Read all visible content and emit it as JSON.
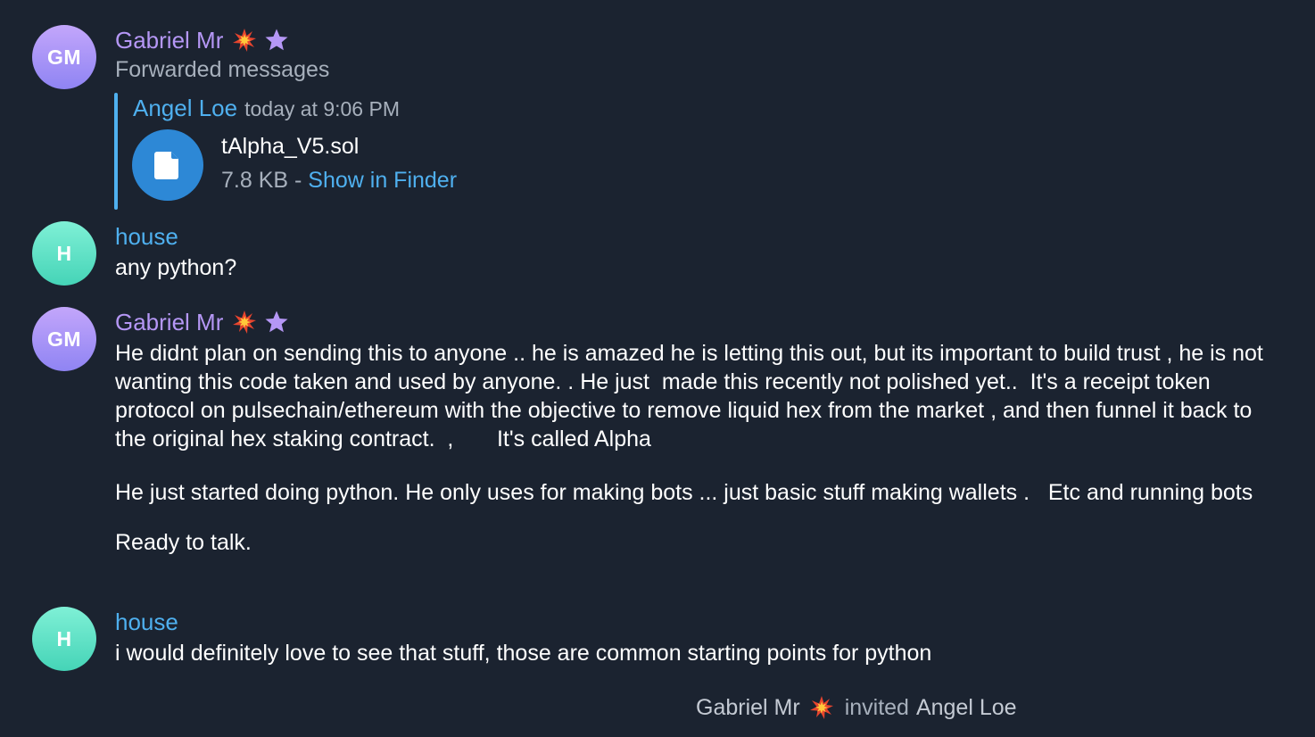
{
  "messages": [
    {
      "avatar_initials": "GM",
      "sender": "Gabriel Mr",
      "sender_badges": [
        "collision-emoji",
        "star-icon"
      ],
      "subtitle": "Forwarded messages",
      "forwarded": {
        "from": "Angel Loe",
        "time": "today at 9:06 PM",
        "file": {
          "icon": "file-icon",
          "name": "tAlpha_V5.sol",
          "size": "7.8 KB",
          "separator": " - ",
          "action": "Show in Finder"
        }
      }
    },
    {
      "avatar_initials": "H",
      "sender": "house",
      "text": "any python?"
    },
    {
      "avatar_initials": "GM",
      "sender": "Gabriel Mr",
      "sender_badges": [
        "collision-emoji",
        "star-icon"
      ],
      "paragraphs": [
        "He didnt plan on sending this to anyone .. he is amazed he is letting this out, but its important to build trust , he is not wanting this code taken and used by anyone. . He just  made this recently not polished yet..  It's a receipt token protocol on pulsechain/ethereum with the objective to remove liquid hex from the market , and then funnel it back to the original hex staking contract.  ,       It's called Alpha",
        "He just started doing python. He only uses for making bots ... just basic stuff making wallets .   Etc and running bots",
        "Ready to talk."
      ]
    },
    {
      "avatar_initials": "H",
      "sender": "house",
      "text": "i would definitely love to see that stuff, those are common starting points for python"
    }
  ],
  "service_message": {
    "actor": "Gabriel Mr",
    "actor_badge": "collision-emoji",
    "verb": "invited",
    "target": "Angel Loe"
  },
  "colors": {
    "background": "#1b2330",
    "purple_name": "#b597f5",
    "blue_name": "#4fb0ef",
    "muted_text": "#a7b0bc",
    "link": "#4fb0ef",
    "file_icon_bg": "#2d88d6"
  }
}
